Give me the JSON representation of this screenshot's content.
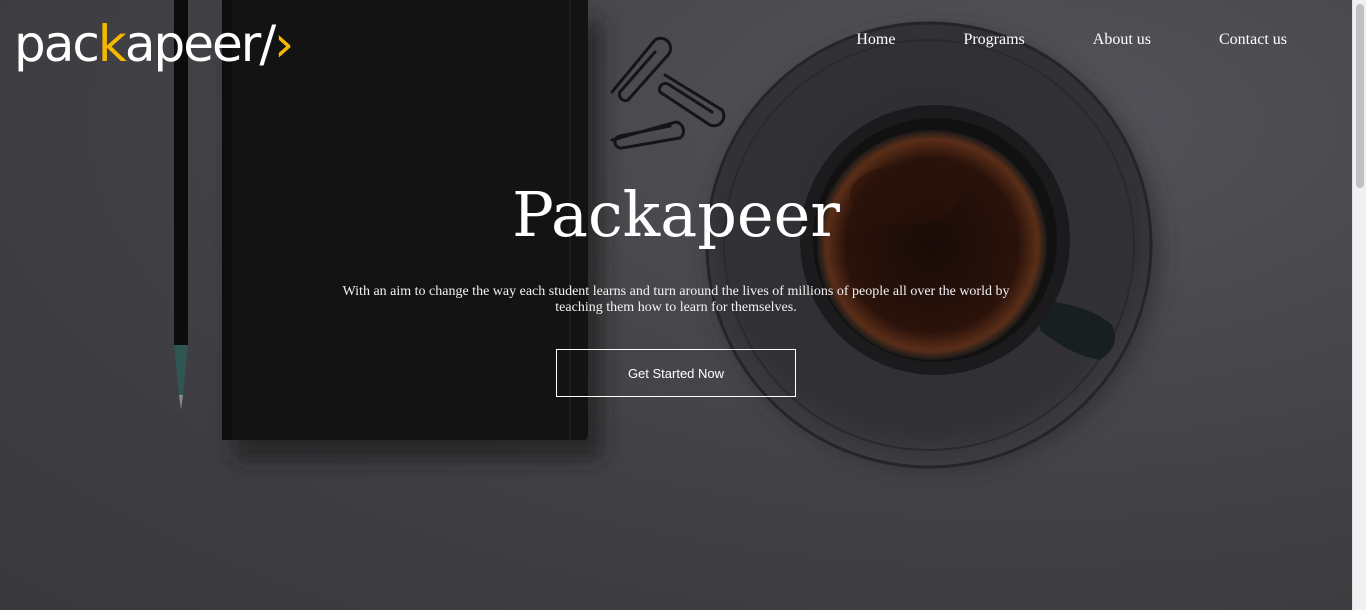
{
  "brand": {
    "logo_pre": "pac",
    "logo_k": "k",
    "logo_post": "apeer",
    "logo_slash": "/",
    "logo_caret": "›",
    "accent_color": "#f5b800"
  },
  "nav": {
    "items": [
      {
        "label": "Home"
      },
      {
        "label": "Programs"
      },
      {
        "label": "About us"
      },
      {
        "label": "Contact us"
      }
    ]
  },
  "hero": {
    "title": "Packapeer",
    "text": "With an aim to change the way each student learns and turn around the lives of millions of people all over the world by teaching them how to learn for themselves.",
    "cta_label": "Get Started Now"
  },
  "background": {
    "icons": [
      "pen-icon",
      "notebook-icon",
      "paperclip-icon",
      "coffee-cup-icon"
    ]
  }
}
